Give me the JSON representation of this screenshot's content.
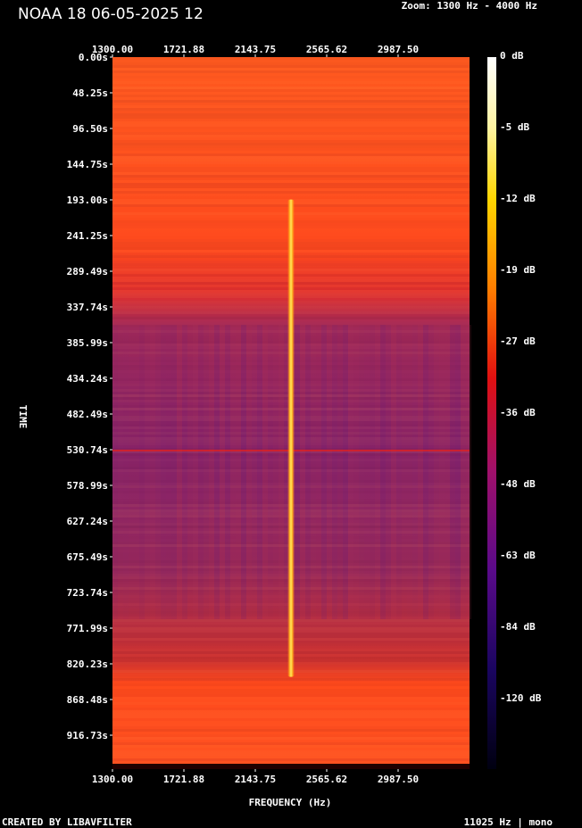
{
  "header": {
    "title": "NOAA 18 06-05-2025 12",
    "zoom_text": "Zoom: 1300 Hz - 4000 Hz"
  },
  "footer": {
    "created_by": "CREATED BY LIBAVFILTER",
    "sample_info": "11025 Hz | mono"
  },
  "chart_data": {
    "type": "heatmap",
    "title": "NOAA 18 06-05-2025 12",
    "xlabel": "FREQUENCY (Hz)",
    "ylabel": "TIME",
    "x_ticks": [
      "1300.00",
      "1721.88",
      "2143.75",
      "2565.62",
      "2987.50"
    ],
    "y_ticks": [
      "0.00s",
      "48.25s",
      "96.50s",
      "144.75s",
      "193.00s",
      "241.25s",
      "289.49s",
      "337.74s",
      "385.99s",
      "434.24s",
      "482.49s",
      "530.74s",
      "578.99s",
      "627.24s",
      "675.49s",
      "723.74s",
      "771.99s",
      "820.23s",
      "868.48s",
      "916.73s"
    ],
    "xlim": [
      1300,
      4000
    ],
    "ylim": [
      0,
      965
    ],
    "colorbar_ticks": [
      "0 dB",
      "-5 dB",
      "-12 dB",
      "-19 dB",
      "-27 dB",
      "-36 dB",
      "-48 dB",
      "-63 dB",
      "-84 dB",
      "-120 dB"
    ],
    "colors": {
      "background_high": "#ff5a1f",
      "background_low": "#7a1e6e",
      "signal": "#ffe040"
    },
    "signal": {
      "frequency_hz": 2650,
      "start_s": 193.0,
      "end_s": 840.0
    }
  }
}
